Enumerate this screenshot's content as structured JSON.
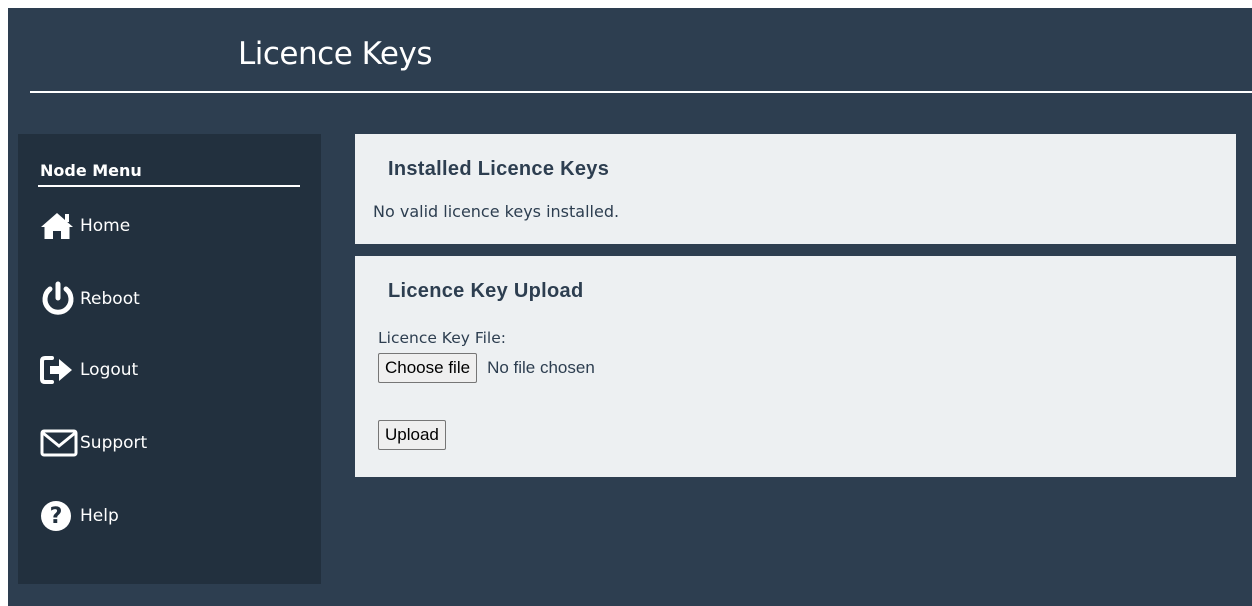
{
  "header": {
    "title": "Licence Keys"
  },
  "sidebar": {
    "title": "Node Menu",
    "items": [
      {
        "label": "Home",
        "icon": "home-icon"
      },
      {
        "label": "Reboot",
        "icon": "power-icon"
      },
      {
        "label": "Logout",
        "icon": "logout-icon"
      },
      {
        "label": "Support",
        "icon": "envelope-icon"
      },
      {
        "label": "Help",
        "icon": "question-circle-icon"
      }
    ]
  },
  "installed": {
    "heading": "Installed Licence Keys",
    "message": "No valid licence keys installed."
  },
  "upload": {
    "heading": "Licence Key Upload",
    "field_label": "Licence Key File:",
    "choose_button": "Choose file",
    "file_status": "No file chosen",
    "upload_button": "Upload"
  },
  "colors": {
    "background": "#2d3e50",
    "sidebar": "#22303e",
    "panel": "#edf0f2",
    "text": "#2d3e50"
  }
}
